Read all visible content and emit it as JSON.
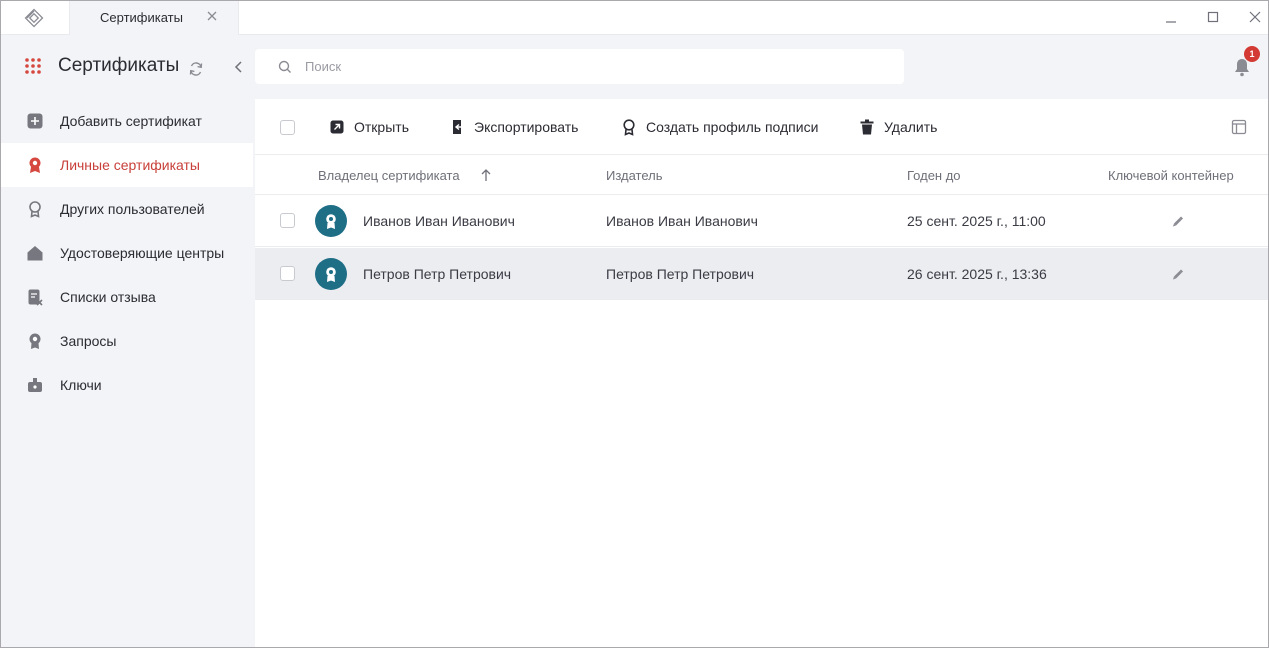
{
  "window": {
    "tab_title": "Сертификаты",
    "icons": {
      "logo": "app-logo-icon",
      "tab_close": "close-icon",
      "minimize": "minimize-icon",
      "maximize": "maximize-icon",
      "close": "close-icon"
    }
  },
  "sidebar": {
    "title": "Сертификаты",
    "items": [
      {
        "label": "Добавить сертификат",
        "icon": "plus-square-icon",
        "active": false
      },
      {
        "label": "Личные сертификаты",
        "icon": "personal-cert-icon",
        "active": true
      },
      {
        "label": "Других пользователей",
        "icon": "award-outline-icon",
        "active": false
      },
      {
        "label": "Удостоверяющие центры",
        "icon": "home-icon",
        "active": false
      },
      {
        "label": "Списки отзыва",
        "icon": "revocation-list-icon",
        "active": false
      },
      {
        "label": "Запросы",
        "icon": "request-icon",
        "active": false
      },
      {
        "label": "Ключи",
        "icon": "key-container-icon",
        "active": false
      }
    ],
    "accent_color": "#c8403a"
  },
  "search": {
    "placeholder": "Поиск",
    "value": ""
  },
  "notifications": {
    "count": "1"
  },
  "toolbar": {
    "open_label": "Открыть",
    "export_label": "Экспортировать",
    "create_profile_label": "Создать профиль подписи",
    "delete_label": "Удалить"
  },
  "table": {
    "columns": [
      "Владелец сертификата",
      "Издатель",
      "Годен до",
      "Ключевой контейнер"
    ],
    "sort_column": "Владелец сертификата",
    "sort_direction": "ascending",
    "rows": [
      {
        "owner": "Иванов Иван Иванович",
        "issuer": "Иванов Иван Иванович",
        "valid_until": "25 сент. 2025 г., 11:00",
        "has_key": true,
        "selected": false
      },
      {
        "owner": "Петров Петр Петрович",
        "issuer": "Петров Петр Петрович",
        "valid_until": "26 сент. 2025 г., 13:36",
        "has_key": true,
        "selected": true
      }
    ],
    "avatar_color": "#1e6e86"
  }
}
